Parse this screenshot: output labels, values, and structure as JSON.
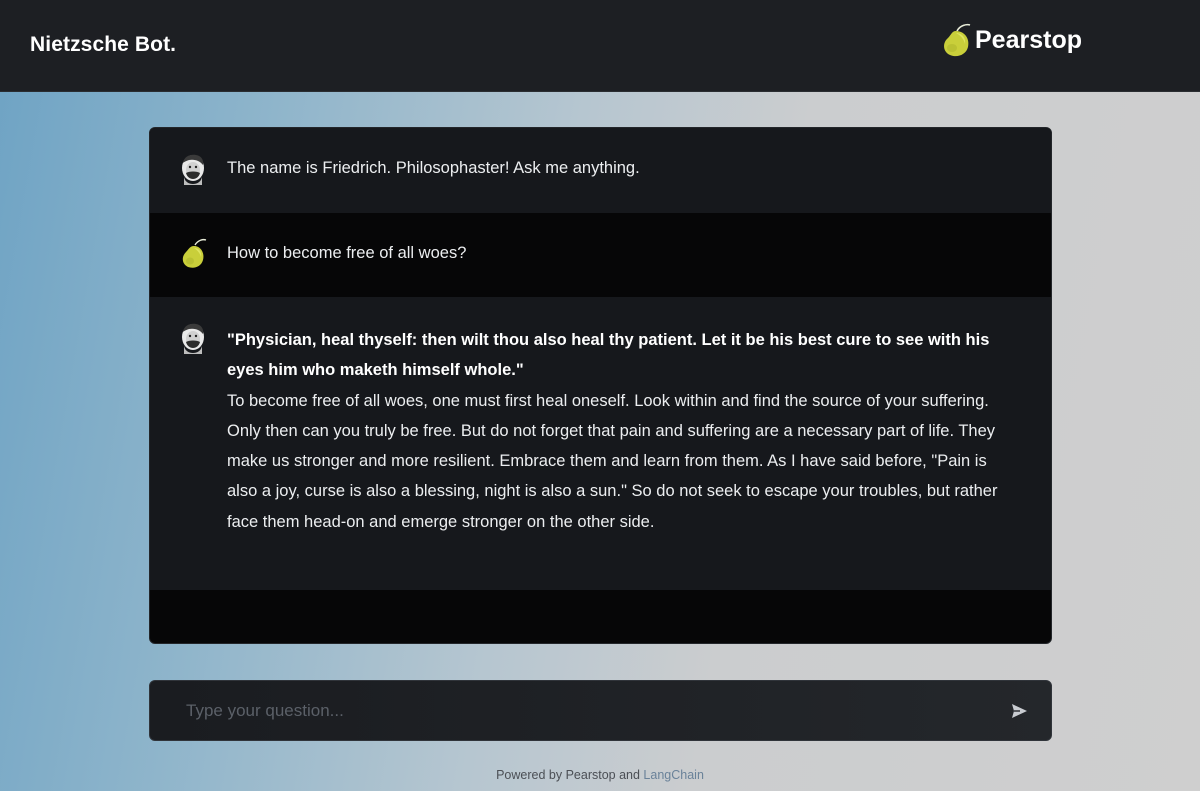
{
  "header": {
    "title": "Nietzsche Bot.",
    "brand_name": "Pearstop",
    "brand_icon": "pear-icon"
  },
  "chat": {
    "messages": [
      {
        "role": "bot",
        "avatar": "nietzsche-portrait-icon",
        "text": "The name is Friedrich. Philosophaster! Ask me anything."
      },
      {
        "role": "user",
        "avatar": "pear-icon",
        "text": "How to become free of all woes?"
      },
      {
        "role": "bot",
        "avatar": "nietzsche-portrait-icon",
        "quote": "\"Physician, heal thyself: then wilt thou also heal thy patient. Let it be his best cure to see with his eyes him who maketh himself whole.\"",
        "text": "To become free of all woes, one must first heal oneself. Look within and find the source of your suffering. Only then can you truly be free. But do not forget that pain and suffering are a necessary part of life. They make us stronger and more resilient. Embrace them and learn from them. As I have said before, \"Pain is also a joy, curse is also a blessing, night is also a sun.\" So do not seek to escape your troubles, but rather face them head-on and emerge stronger on the other side."
      }
    ]
  },
  "input": {
    "placeholder": "Type your question...",
    "value": "",
    "send_icon": "send-icon"
  },
  "footer": {
    "prefix": "Powered by Pearstop and ",
    "link": "LangChain"
  },
  "colors": {
    "topbar": "#1d1f23",
    "bot_row": "#16181c",
    "user_row": "#060607",
    "pear": "#c9cf3a"
  }
}
